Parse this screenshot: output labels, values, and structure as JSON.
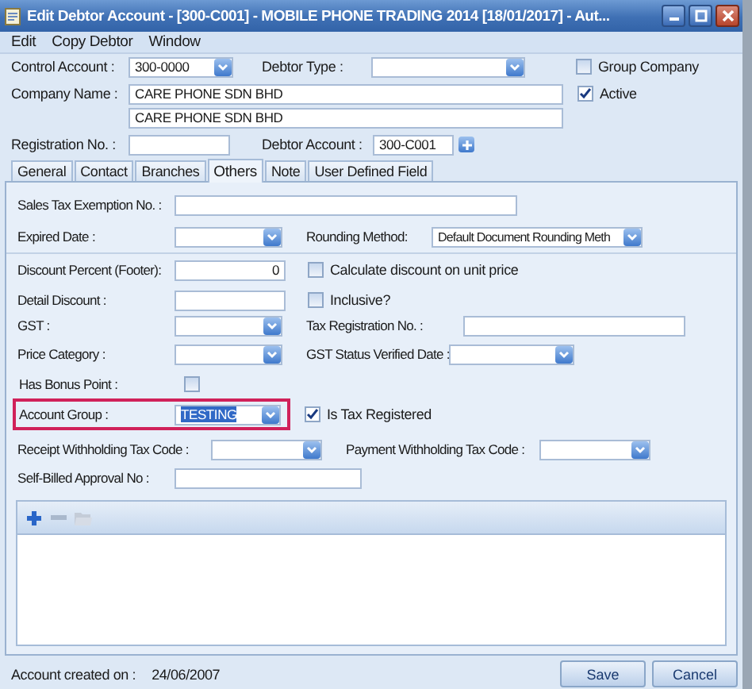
{
  "window": {
    "title": "Edit Debtor Account - [300-C001] - MOBILE PHONE TRADING 2014 [18/01/2017] - Aut..."
  },
  "menu": [
    {
      "label": "Edit"
    },
    {
      "label": "Copy Debtor"
    },
    {
      "label": "Window"
    }
  ],
  "header": {
    "control_account": {
      "label": "Control Account :",
      "value": "300-0000"
    },
    "debtor_type": {
      "label": "Debtor Type :"
    },
    "group_company": {
      "label": "Group Company",
      "checked": false
    },
    "active": {
      "label": "Active",
      "checked": true
    },
    "company_name": {
      "label": "Company Name :",
      "value": "CARE PHONE SDN BHD",
      "value_2": "CARE PHONE SDN BHD"
    },
    "registration_no": {
      "label": "Registration No. :"
    },
    "debtor_account": {
      "label": "Debtor Account :",
      "value": "300-C001"
    }
  },
  "tabs": [
    {
      "label": "General",
      "selected": false
    },
    {
      "label": "Contact",
      "selected": false
    },
    {
      "label": "Branches",
      "selected": false
    },
    {
      "label": "Others",
      "selected": true
    },
    {
      "label": "Note",
      "selected": false
    },
    {
      "label": "User Defined Field",
      "selected": false
    }
  ],
  "others": {
    "sales_tax_exemption_no": {
      "label": "Sales Tax Exemption No. :"
    },
    "expired_date": {
      "label": "Expired Date :"
    },
    "rounding_method": {
      "label": "Rounding Method:",
      "value": "Default Document Rounding Meth"
    },
    "discount_percent": {
      "label": "Discount Percent (Footer):",
      "value": "0"
    },
    "calculate_discount": {
      "label": "Calculate discount on unit price",
      "checked": false
    },
    "detail_discount": {
      "label": "Detail Discount :"
    },
    "inclusive": {
      "label": "Inclusive?",
      "checked": false
    },
    "gst": {
      "label": "GST :"
    },
    "tax_registration_no": {
      "label": "Tax Registration No. :"
    },
    "price_category": {
      "label": "Price Category :"
    },
    "gst_status_verified_date": {
      "label": "GST Status Verified Date :"
    },
    "has_bonus_point": {
      "label": "Has Bonus Point :",
      "checked": false
    },
    "account_group": {
      "label": "Account Group :",
      "value": "TESTING",
      "highlighted": true,
      "text_selected": true
    },
    "is_tax_registered": {
      "label": "Is Tax Registered",
      "checked": true
    },
    "receipt_withholding_tax_code": {
      "label": "Receipt Withholding Tax Code :"
    },
    "payment_withholding_tax_code": {
      "label": "Payment Withholding Tax Code :"
    },
    "self_billed_approval_no": {
      "label": "Self-Billed Approval No :"
    }
  },
  "footer": {
    "created_label": "Account created on :",
    "created_date": "24/06/2007"
  },
  "buttons": [
    {
      "label": "Save"
    },
    {
      "label": "Cancel"
    }
  ]
}
